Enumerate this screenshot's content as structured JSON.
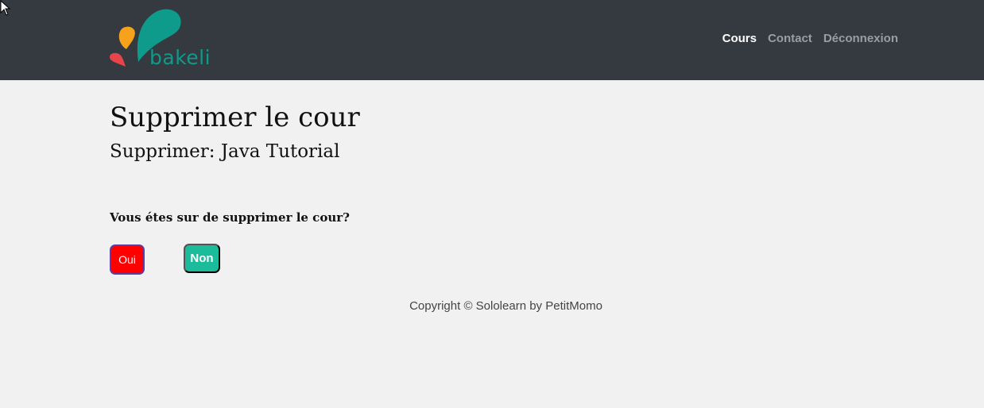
{
  "header": {
    "logo_text": "bakeli",
    "nav": [
      {
        "label": "Cours",
        "active": true
      },
      {
        "label": "Contact",
        "active": false
      },
      {
        "label": "Déconnexion",
        "active": false
      }
    ]
  },
  "main": {
    "title": "Supprimer le cour",
    "subtitle": "Supprimer: Java Tutorial",
    "confirm_question": "Vous étes sur de supprimer le cour?",
    "yes_label": "Oui",
    "no_label": "Non"
  },
  "footer": {
    "copyright": "Copyright © Sololearn by PetitMomo"
  },
  "colors": {
    "navbar_bg": "#343a40",
    "page_bg": "#f1f1f1",
    "brand_teal": "#0e9b8b",
    "brand_orange": "#f7a21b",
    "brand_red": "#e8454b",
    "danger_button": "#ff0000",
    "success_button": "#1abc9c"
  }
}
